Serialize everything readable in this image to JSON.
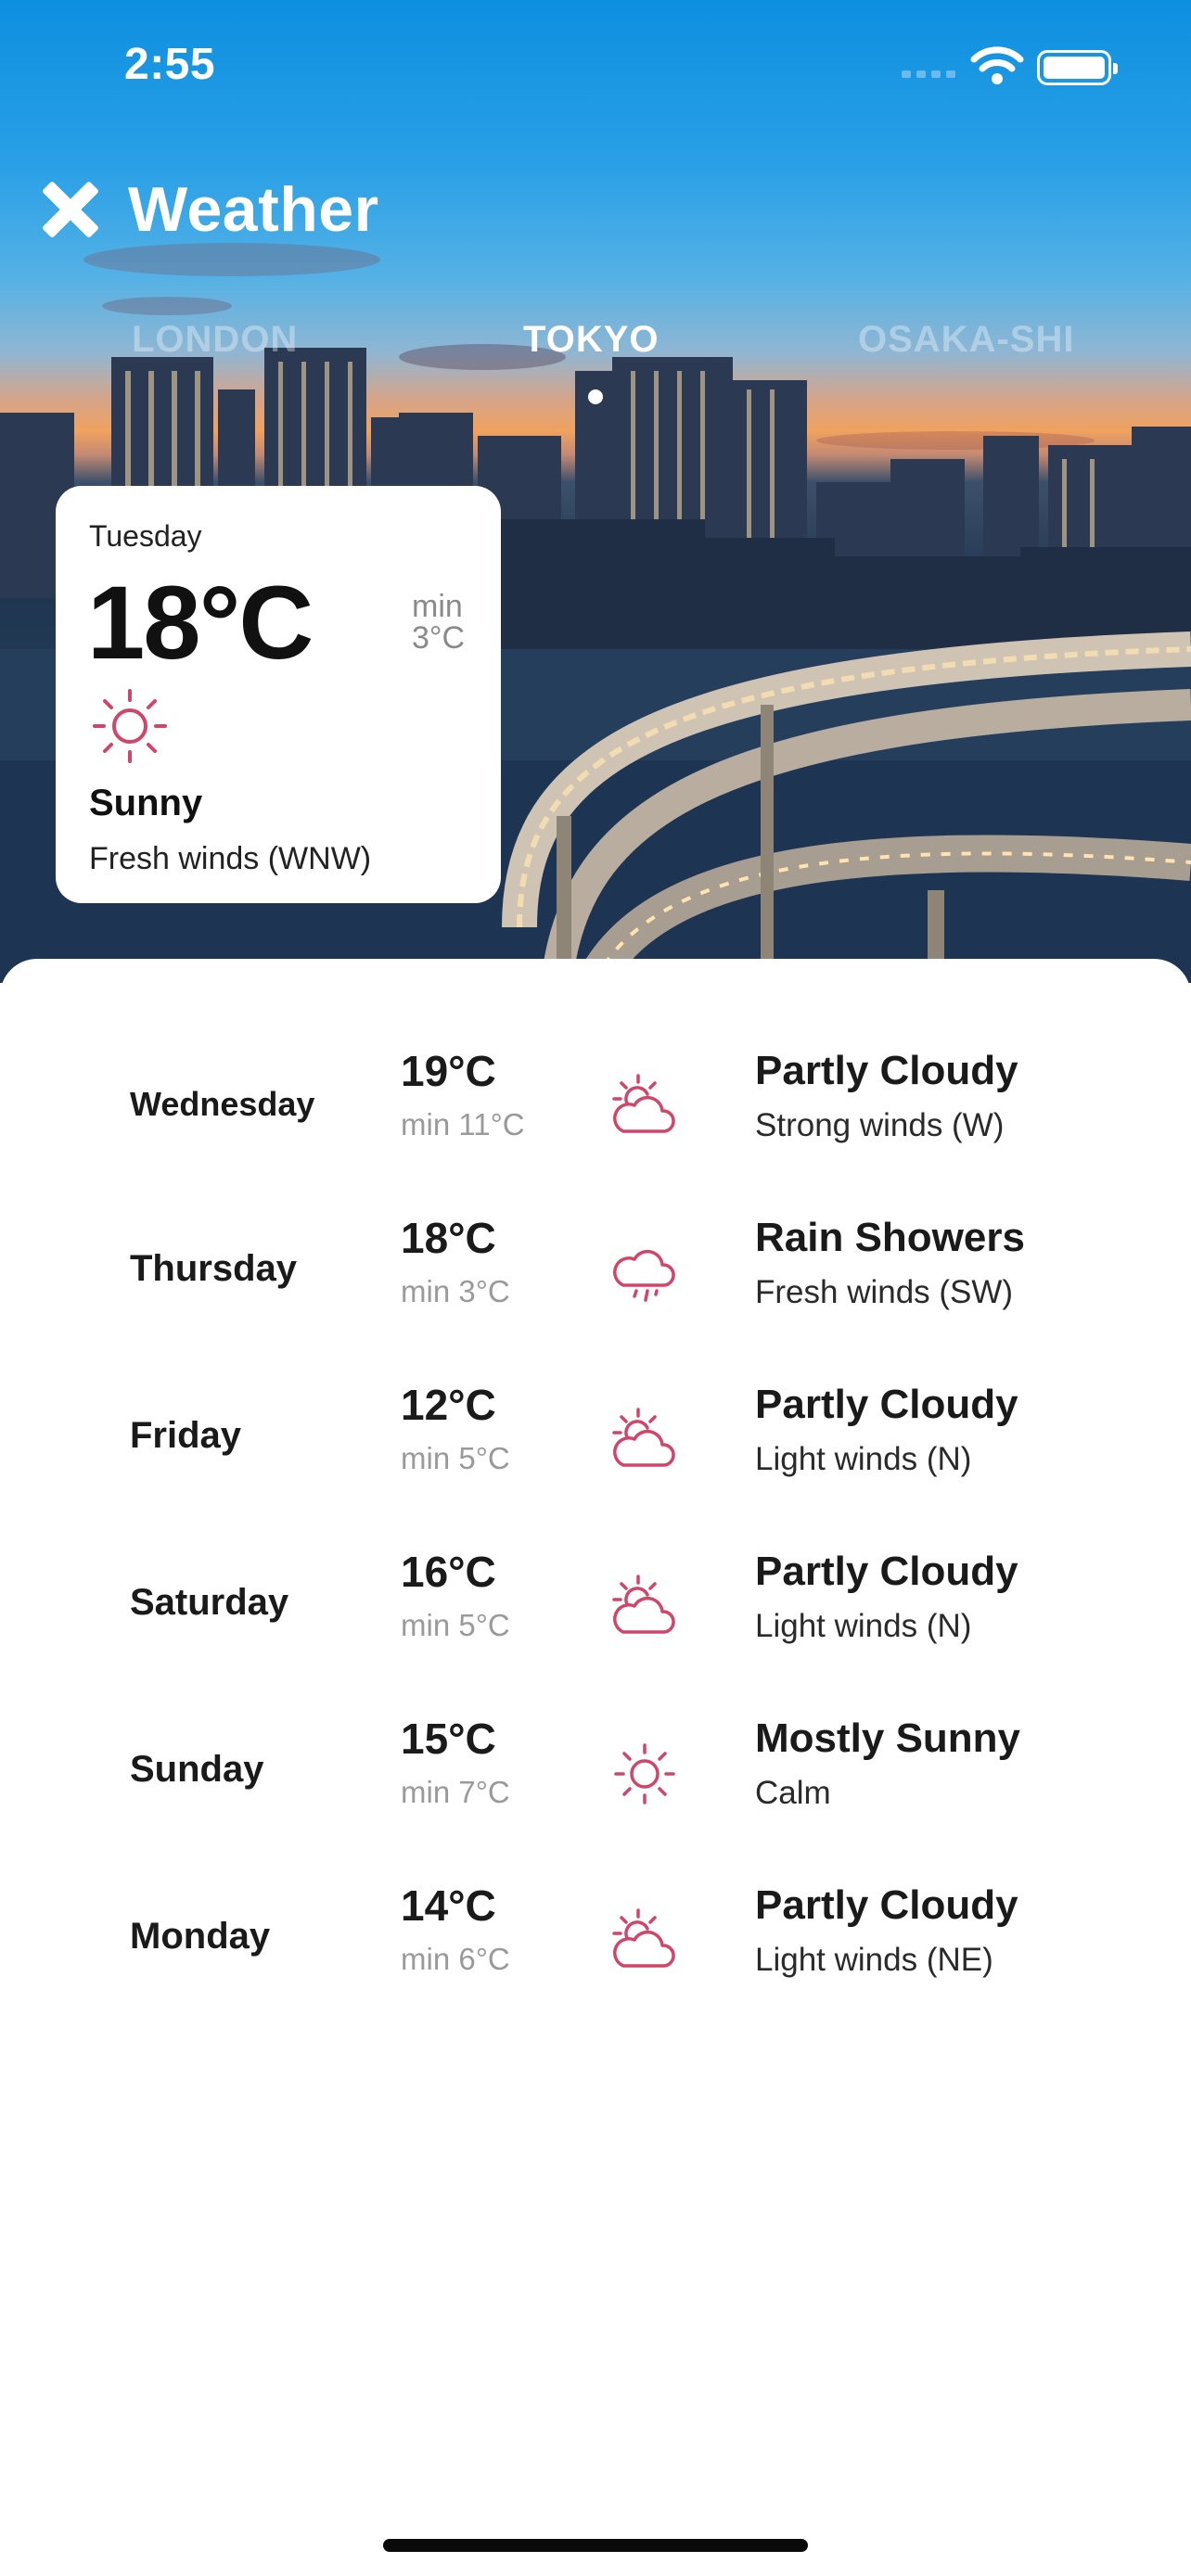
{
  "status_bar": {
    "time": "2:55"
  },
  "header": {
    "title": "Weather"
  },
  "cities": [
    {
      "label": "LONDON",
      "active": false
    },
    {
      "label": "TOKYO",
      "active": true
    },
    {
      "label": "OSAKA-SHI",
      "active": false
    }
  ],
  "today": {
    "day": "Tuesday",
    "temp": "18°C",
    "min_label": "min",
    "min_value": "3°C",
    "icon": "sun-icon",
    "condition": "Sunny",
    "wind": "Fresh winds (WNW)"
  },
  "forecast": [
    {
      "day": "Wednesday",
      "high": "19°C",
      "low": "min 11°C",
      "icon": "partly-cloudy-icon",
      "condition": "Partly Cloudy",
      "wind": "Strong winds (W)"
    },
    {
      "day": "Thursday",
      "high": "18°C",
      "low": "min 3°C",
      "icon": "rain-showers-icon",
      "condition": "Rain Showers",
      "wind": "Fresh winds (SW)"
    },
    {
      "day": "Friday",
      "high": "12°C",
      "low": "min 5°C",
      "icon": "partly-cloudy-icon",
      "condition": "Partly Cloudy",
      "wind": "Light winds (N)"
    },
    {
      "day": "Saturday",
      "high": "16°C",
      "low": "min 5°C",
      "icon": "partly-cloudy-icon",
      "condition": "Partly Cloudy",
      "wind": "Light winds (N)"
    },
    {
      "day": "Sunday",
      "high": "15°C",
      "low": "min 7°C",
      "icon": "sun-icon",
      "condition": "Mostly Sunny",
      "wind": "Calm"
    },
    {
      "day": "Monday",
      "high": "14°C",
      "low": "min 6°C",
      "icon": "partly-cloudy-icon",
      "condition": "Partly Cloudy",
      "wind": "Light winds (NE)"
    }
  ],
  "colors": {
    "accent": "#d2456a",
    "sky_top": "#0d8fe0",
    "text": "#1a1a1a",
    "muted": "#9a9a9a"
  }
}
